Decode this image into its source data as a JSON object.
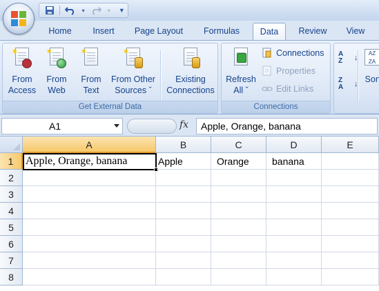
{
  "quick_access": {
    "items": [
      "save-icon",
      "undo-icon",
      "redo-icon",
      "customize-icon"
    ]
  },
  "tabs": [
    {
      "id": "home",
      "label": "Home"
    },
    {
      "id": "insert",
      "label": "Insert"
    },
    {
      "id": "page-layout",
      "label": "Page Layout"
    },
    {
      "id": "formulas",
      "label": "Formulas"
    },
    {
      "id": "data",
      "label": "Data",
      "active": true
    },
    {
      "id": "review",
      "label": "Review"
    },
    {
      "id": "view",
      "label": "View"
    }
  ],
  "ribbon": {
    "get_external_data": {
      "label": "Get External Data",
      "buttons": [
        {
          "id": "from-access",
          "line1": "From",
          "line2": "Access",
          "icon": "access-icon"
        },
        {
          "id": "from-web",
          "line1": "From",
          "line2": "Web",
          "icon": "web-icon"
        },
        {
          "id": "from-text",
          "line1": "From",
          "line2": "Text",
          "icon": "text-icon"
        },
        {
          "id": "from-other",
          "line1": "From Other",
          "line2": "Sources ˇ",
          "icon": "other-sources-icon"
        },
        {
          "id": "existing",
          "line1": "Existing",
          "line2": "Connections",
          "icon": "existing-connections-icon"
        }
      ]
    },
    "connections": {
      "label": "Connections",
      "refresh": {
        "line1": "Refresh",
        "line2": "All ˇ"
      },
      "connections_label": "Connections",
      "properties_label": "Properties",
      "edit_links_label": "Edit Links"
    },
    "sort": {
      "label": "Sort"
    }
  },
  "formula_bar": {
    "name_box": "A1",
    "fx": "fx",
    "formula": "Apple, Orange, banana"
  },
  "grid": {
    "columns": [
      "A",
      "B",
      "C",
      "D",
      "E"
    ],
    "selected_column": "A",
    "rows": [
      "1",
      "2",
      "3",
      "4",
      "5",
      "6",
      "7",
      "8"
    ],
    "selected_row": "1",
    "cells": {
      "A1": "Apple, Orange, banana",
      "B1": "Apple",
      "C1": "Orange",
      "D1": "banana"
    },
    "active_cell": "A1"
  },
  "colors": {
    "accent": "#15428b",
    "selection_header": "#f7c96b",
    "grid_line": "#d0d7e5"
  }
}
